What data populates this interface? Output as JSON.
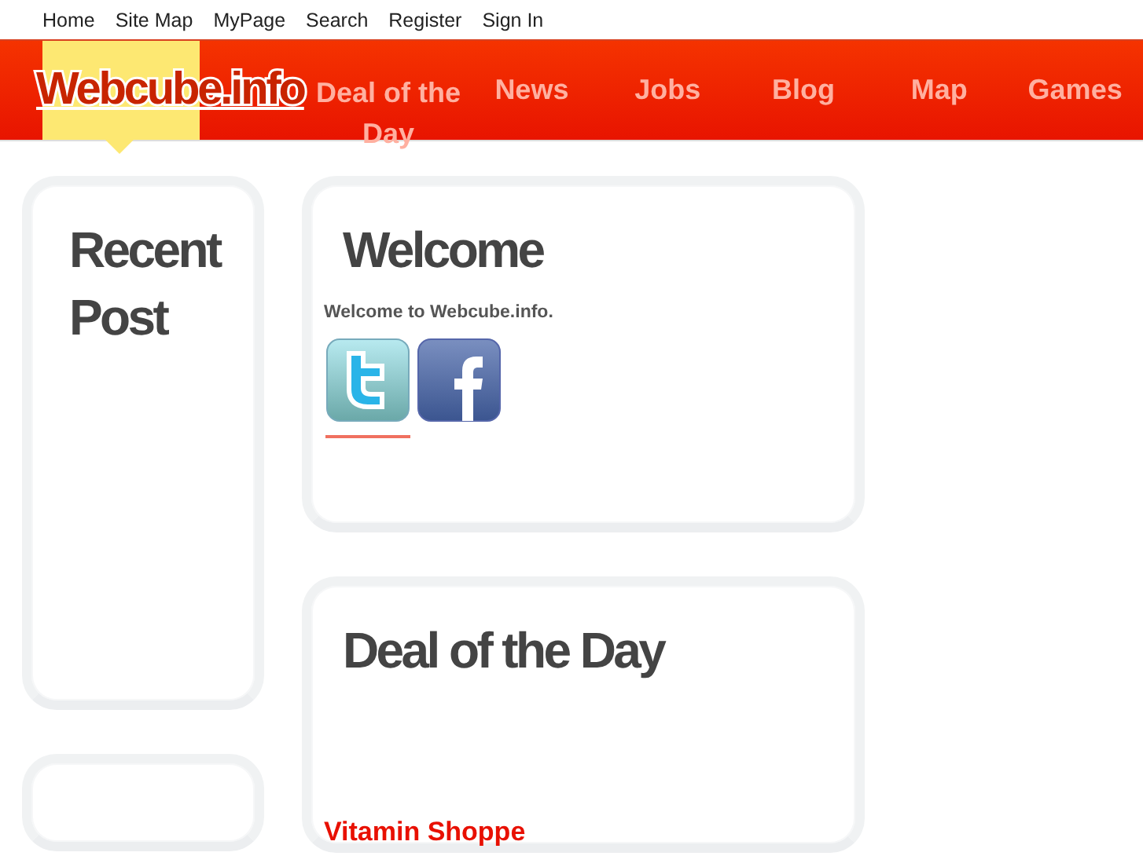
{
  "top_links": [
    "Home",
    "Site Map",
    "MyPage",
    "Search",
    "Register",
    "Sign In"
  ],
  "nav": [
    {
      "kind": "logo",
      "label": "Webcube.info",
      "selected": true
    },
    {
      "kind": "tab",
      "label": "Deal of the Day",
      "selected": false
    },
    {
      "kind": "tab",
      "label": "News",
      "selected": false
    },
    {
      "kind": "tab",
      "label": "Jobs",
      "selected": false
    },
    {
      "kind": "tab",
      "label": "Blog",
      "selected": false
    },
    {
      "kind": "tab",
      "label": "Map",
      "selected": false
    },
    {
      "kind": "tab",
      "label": "Games",
      "selected": false
    }
  ],
  "sidebar": [
    {
      "kind": "titled",
      "title": "Recent Post"
    },
    {
      "kind": "blank"
    }
  ],
  "main": [
    {
      "title": "Welcome",
      "text": "Welcome to Webcube.info.",
      "social": [
        {
          "kind": "twitter",
          "underlined": true
        },
        {
          "kind": "facebook",
          "underlined": false
        }
      ]
    },
    {
      "title": "Deal of the Day",
      "link": "Vitamin Shoppe"
    }
  ]
}
